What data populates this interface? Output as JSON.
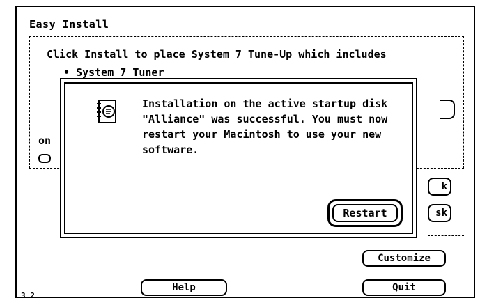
{
  "window": {
    "title": "Easy Install",
    "description": "Click Install to place System 7 Tune-Up which includes",
    "bullet": "• System 7 Tuner",
    "truncated_text": "on"
  },
  "buttons": {
    "ok_partial": "k",
    "disk_partial": "sk",
    "customize": "Customize",
    "help": "Help",
    "quit": "Quit"
  },
  "version": "3.2",
  "alert": {
    "icon": "document-icon",
    "message_lines": [
      "Installation on the active startup disk",
      "\"Alliance\" was successful.  You must now",
      "restart your Macintosh to use your new",
      "software."
    ],
    "restart_label": "Restart"
  }
}
